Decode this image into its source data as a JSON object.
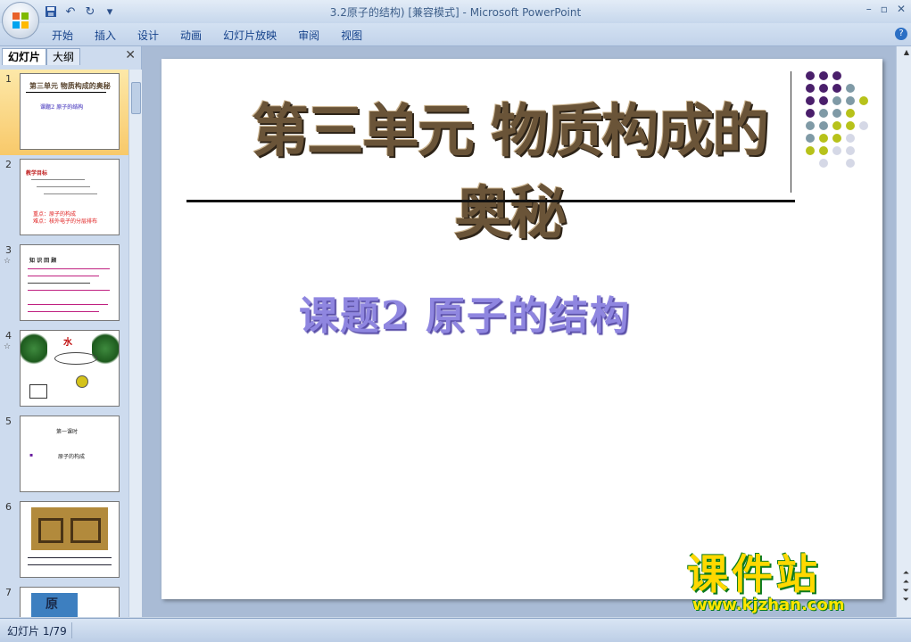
{
  "window": {
    "title": "3.2原子的结构) [兼容模式] - Microsoft PowerPoint",
    "min": "–",
    "restore": "▫",
    "close": "✕"
  },
  "quick_access": [
    "save-icon",
    "undo-icon",
    "redo-icon",
    "customize-icon"
  ],
  "ribbon": {
    "tabs": [
      "开始",
      "插入",
      "设计",
      "动画",
      "幻灯片放映",
      "审阅",
      "视图"
    ],
    "help": "?"
  },
  "left_pane": {
    "tab_slides": "幻灯片",
    "tab_outline": "大纲",
    "close": "✕",
    "slides": [
      {
        "num": "1",
        "texts": [
          "第三单元  物质构成的奥秘",
          "课题2  原子的结构"
        ],
        "selected": true
      },
      {
        "num": "2",
        "texts": [
          "教学目标",
          "重点：原子的构成",
          "难点：核外电子的分层排布"
        ]
      },
      {
        "num": "3",
        "star": "☆",
        "texts": [
          "知 识 回 顾"
        ]
      },
      {
        "num": "4",
        "star": "☆",
        "texts": [
          "水"
        ]
      },
      {
        "num": "5",
        "texts": [
          "第一课时",
          "原子的构成"
        ]
      },
      {
        "num": "6",
        "texts": []
      },
      {
        "num": "7",
        "texts": [
          "原"
        ]
      }
    ]
  },
  "slide": {
    "title": "第三单元   物质构成的奥秘",
    "subtitle": "课题2   原子的结构"
  },
  "watermark": {
    "brand": "课件站",
    "url": "www.kjzhan.com"
  },
  "status": {
    "slide_counter": "幻灯片 1/79"
  },
  "colors": {
    "dot_purple": "#4a1f6b",
    "dot_teal": "#7f9aa6",
    "dot_lime": "#b7c21a",
    "dot_light": "#d5d8e6"
  }
}
